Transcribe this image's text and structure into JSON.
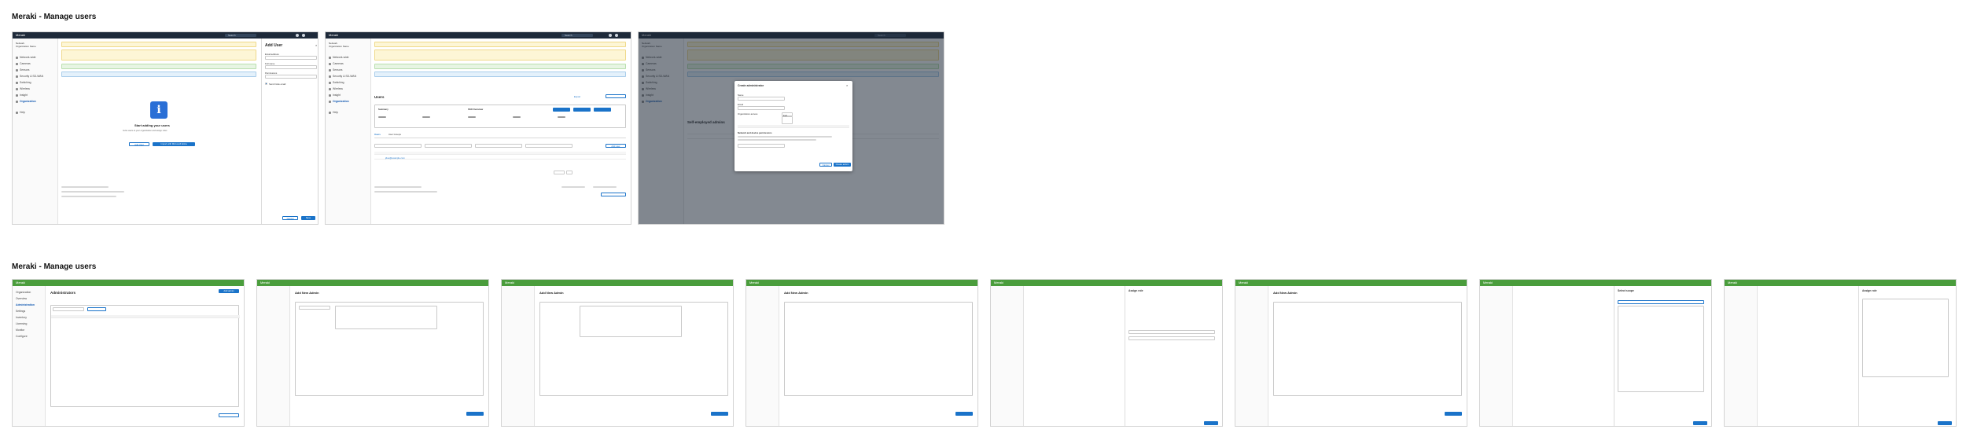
{
  "sections": [
    {
      "title": "Meraki - Manage users"
    },
    {
      "title": "Meraki - Manage users"
    }
  ],
  "app": {
    "brand": "Meraki",
    "brand_green": "Meraki",
    "search_placeholder": "Search"
  },
  "sidebar": {
    "network_label": "Network",
    "network_name": "Organization Name",
    "items": [
      "Network-wide",
      "Cameras",
      "Sensors",
      "Security & SD-WAN",
      "Switching",
      "Wireless",
      "Insight",
      "Organization",
      "Help"
    ],
    "green_items": [
      "Organization",
      "Overview",
      "Administration",
      "Settings",
      "Inventory",
      "Licensing",
      "Monitor",
      "Configure"
    ]
  },
  "screen1": {
    "panel_title": "Add User",
    "field_email": "Email address",
    "field_name": "Full name",
    "field_role": "Permissions",
    "checkbox": "Send invite email",
    "empty_title": "Start adding your users",
    "empty_text": "Invite users to your organization and assign roles",
    "btn_add": "Add User",
    "btn_import": "Import with Microsoft Entra",
    "btn_cancel": "Cancel",
    "btn_save": "Save"
  },
  "screen2": {
    "title": "Users",
    "summary": "Summary",
    "sso_label": "SSO Overview",
    "tab_users": "Users",
    "tab_groups": "User Groups",
    "btn_add": "Add user",
    "export_label": "Export",
    "user_email": "jdoe@example.com"
  },
  "screen3": {
    "modal_title": "Create administrator",
    "field_name": "Name",
    "field_email": "Email",
    "field_access": "Organization access",
    "select_value": "Full",
    "section_label": "Network and device permissions",
    "btn_cancel": "Cancel",
    "btn_create": "Create admin",
    "bg_title": "Self-employed admins"
  },
  "screen4": {
    "page_title": "Administrators",
    "btn_add": "Add admin"
  },
  "screen5": {
    "title": "Add New Admin"
  },
  "screen6": {
    "title": "Add New Admin"
  },
  "screen7": {
    "title": "Add New Admin"
  },
  "screen8": {
    "title": "Assign role"
  },
  "screen9": {
    "title": "Add New Admin"
  },
  "screen10": {
    "title": "Select scope"
  },
  "screen11": {
    "title": "Assign role"
  },
  "colors": {
    "meraki_dark": "#1e2a3a",
    "meraki_green": "#4a9d3c",
    "primary_blue": "#1a73c9"
  }
}
